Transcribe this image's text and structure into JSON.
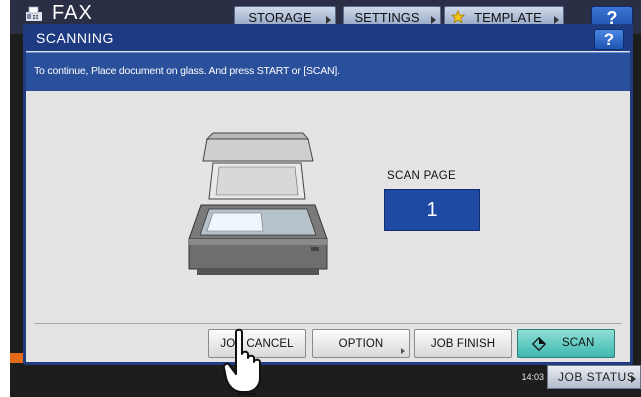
{
  "background": {
    "app_title": "FAX",
    "tabs": [
      {
        "label": "STORAGE"
      },
      {
        "label": "SETTINGS"
      },
      {
        "label": "TEMPLATE"
      }
    ],
    "help_label": "?",
    "time": "14:03",
    "job_status_label": "JOB STATUS"
  },
  "dialog": {
    "title": "SCANNING",
    "help_label": "?",
    "message": "To continue, Place document on glass. And press START or [SCAN].",
    "scan_page": {
      "label": "SCAN PAGE",
      "value": "1"
    },
    "buttons": {
      "job_cancel": "JOB CANCEL",
      "option": "OPTION",
      "job_finish": "JOB FINISH",
      "scan": "SCAN"
    }
  },
  "colors": {
    "title_bar": "#1e3a80",
    "message_bar": "#2a4f9b",
    "scan_page_box": "#1f4aa3",
    "scan_button": "#3fb8b0",
    "dialog_body": "#e4e4e4"
  },
  "icons": {
    "fax": "fax-icon",
    "template_star": "star-icon",
    "copier": "copier-illustration-icon",
    "scan_start": "diamond-start-icon",
    "pointer": "hand-pointer-icon"
  }
}
